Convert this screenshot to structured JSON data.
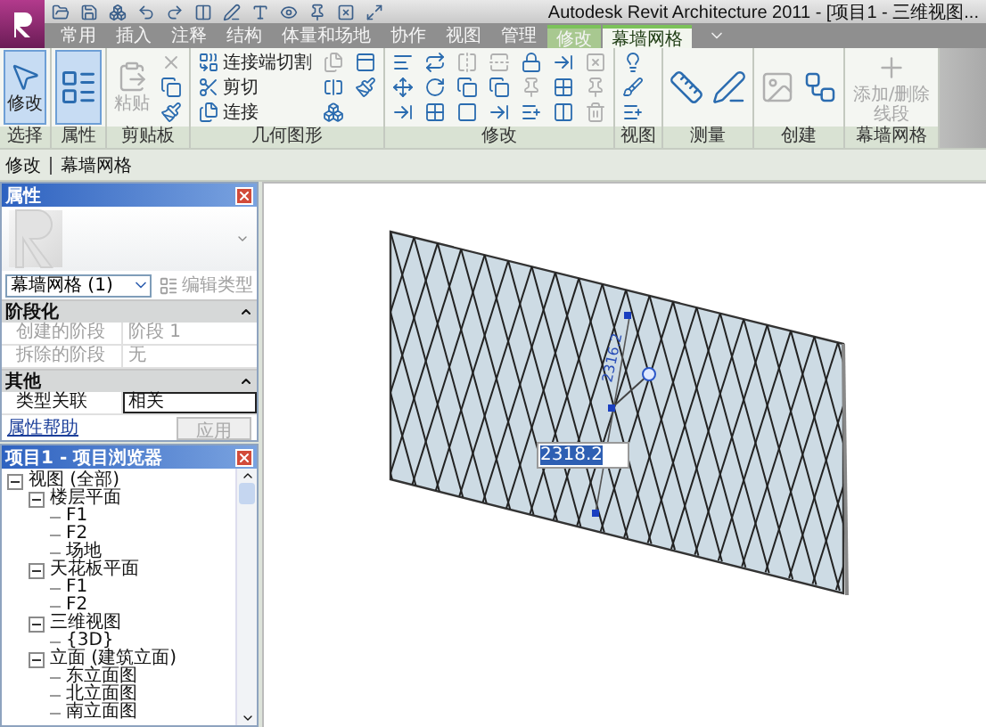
{
  "window": {
    "title": "Autodesk Revit Architecture 2011 - [项目1 - 三维视图..."
  },
  "tabs": [
    {
      "label": "常用",
      "selected": false
    },
    {
      "label": "插入",
      "selected": false
    },
    {
      "label": "注释",
      "selected": false
    },
    {
      "label": "结构",
      "selected": false
    },
    {
      "label": "体量和场地",
      "selected": false
    },
    {
      "label": "协作",
      "selected": false
    },
    {
      "label": "视图",
      "selected": false
    },
    {
      "label": "管理",
      "selected": false
    },
    {
      "label": "修改",
      "selected": false
    },
    {
      "label": "幕墙网格",
      "selected": true
    }
  ],
  "ribbon": {
    "panels": [
      {
        "label": "选择",
        "tools": [
          {
            "kind": "large",
            "label": "修改",
            "selected": true,
            "disabled": false
          }
        ]
      },
      {
        "label": "属性",
        "tools": [
          {
            "kind": "large",
            "selected": true,
            "disabled": false
          }
        ]
      },
      {
        "label": "剪贴板",
        "tools": [
          {
            "kind": "large",
            "label": "粘贴",
            "selected": false,
            "disabled": true
          },
          {
            "kind": "small",
            "selected": false,
            "disabled": true
          },
          {
            "kind": "small",
            "selected": false,
            "disabled": false
          },
          {
            "kind": "small",
            "selected": false,
            "disabled": false
          }
        ]
      },
      {
        "label": "几何图形",
        "tools": [
          {
            "kind": "small",
            "label": "连接端切割",
            "selected": false,
            "disabled": false
          },
          {
            "kind": "small",
            "label": "剪切",
            "selected": false,
            "disabled": false
          },
          {
            "kind": "small",
            "label": "连接",
            "selected": false,
            "disabled": false
          },
          {
            "kind": "small",
            "selected": false,
            "disabled": true
          },
          {
            "kind": "small",
            "selected": false,
            "disabled": false
          },
          {
            "kind": "small",
            "selected": false,
            "disabled": false
          },
          {
            "kind": "small",
            "selected": false,
            "disabled": false
          },
          {
            "kind": "small",
            "selected": false,
            "disabled": false
          }
        ]
      },
      {
        "label": "修改",
        "tools": [
          {
            "kind": "small",
            "selected": false,
            "disabled": false
          },
          {
            "kind": "small",
            "selected": false,
            "disabled": false
          },
          {
            "kind": "small",
            "selected": false,
            "disabled": false
          },
          {
            "kind": "small",
            "selected": false,
            "disabled": false
          },
          {
            "kind": "small",
            "selected": false,
            "disabled": false
          },
          {
            "kind": "small",
            "selected": false,
            "disabled": false
          },
          {
            "kind": "small",
            "selected": false,
            "disabled": true
          },
          {
            "kind": "small",
            "selected": false,
            "disabled": false
          },
          {
            "kind": "small",
            "selected": false,
            "disabled": false
          },
          {
            "kind": "small",
            "selected": false,
            "disabled": true
          },
          {
            "kind": "small",
            "selected": false,
            "disabled": false
          },
          {
            "kind": "small",
            "selected": false,
            "disabled": false
          },
          {
            "kind": "small",
            "selected": false,
            "disabled": false
          },
          {
            "kind": "small",
            "selected": false,
            "disabled": true
          },
          {
            "kind": "small",
            "selected": false,
            "disabled": false
          },
          {
            "kind": "small",
            "selected": false,
            "disabled": false
          },
          {
            "kind": "small",
            "selected": false,
            "disabled": false
          },
          {
            "kind": "small",
            "selected": false,
            "disabled": false
          },
          {
            "kind": "small",
            "selected": false,
            "disabled": true
          },
          {
            "kind": "small",
            "selected": false,
            "disabled": true
          },
          {
            "kind": "small",
            "selected": false,
            "disabled": true
          }
        ]
      },
      {
        "label": "视图",
        "tools": [
          {
            "kind": "small",
            "selected": false,
            "disabled": false
          },
          {
            "kind": "small",
            "selected": false,
            "disabled": false
          },
          {
            "kind": "small",
            "selected": false,
            "disabled": false
          }
        ]
      },
      {
        "label": "测量",
        "tools": [
          {
            "kind": "medium",
            "selected": false,
            "disabled": false
          },
          {
            "kind": "medium",
            "selected": false,
            "disabled": false
          }
        ]
      },
      {
        "label": "创建",
        "tools": [
          {
            "kind": "medium",
            "selected": false,
            "disabled": true
          },
          {
            "kind": "medium",
            "selected": false,
            "disabled": false
          }
        ]
      },
      {
        "label": "幕墙网格",
        "tools": [
          {
            "kind": "large",
            "label": "添加/删除线段",
            "selected": false,
            "disabled": true
          }
        ]
      }
    ]
  },
  "options_bar": {
    "items": [
      "修改",
      "幕墙网格"
    ]
  },
  "properties": {
    "title": "属性",
    "type_selector": "幕墙网格 (1)",
    "edit_type": {
      "label": "编辑类型",
      "disabled": true
    },
    "groups": [
      {
        "name": "阶段化",
        "expanded": true,
        "rows": [
          {
            "label": "创建的阶段",
            "value": "阶段 1",
            "disabled": true,
            "selected": false
          },
          {
            "label": "拆除的阶段",
            "value": "无",
            "disabled": true,
            "selected": false
          }
        ]
      },
      {
        "name": "其他",
        "expanded": true,
        "rows": [
          {
            "label": "类型关联",
            "value": "相关",
            "disabled": false,
            "selected": true
          }
        ]
      }
    ],
    "help_link": "属性帮助",
    "apply": {
      "label": "应用",
      "disabled": true
    }
  },
  "project_browser": {
    "title": "项目1 - 项目浏览器",
    "tree": [
      {
        "label": "视图 (全部)",
        "expanded": true,
        "children": [
          {
            "label": "楼层平面",
            "expanded": true,
            "children": [
              {
                "label": "F1"
              },
              {
                "label": "F2"
              },
              {
                "label": "场地"
              }
            ]
          },
          {
            "label": "天花板平面",
            "expanded": true,
            "children": [
              {
                "label": "F1"
              },
              {
                "label": "F2"
              }
            ]
          },
          {
            "label": "三维视图",
            "expanded": true,
            "children": [
              {
                "label": "{3D}"
              }
            ]
          },
          {
            "label": "立面 (建筑立面)",
            "expanded": true,
            "children": [
              {
                "label": "东立面图"
              },
              {
                "label": "北立面图"
              },
              {
                "label": "南立面图"
              }
            ]
          }
        ]
      }
    ]
  },
  "canvas": {
    "dimension_input": "2318.2",
    "dimension_label": "2316.2"
  }
}
